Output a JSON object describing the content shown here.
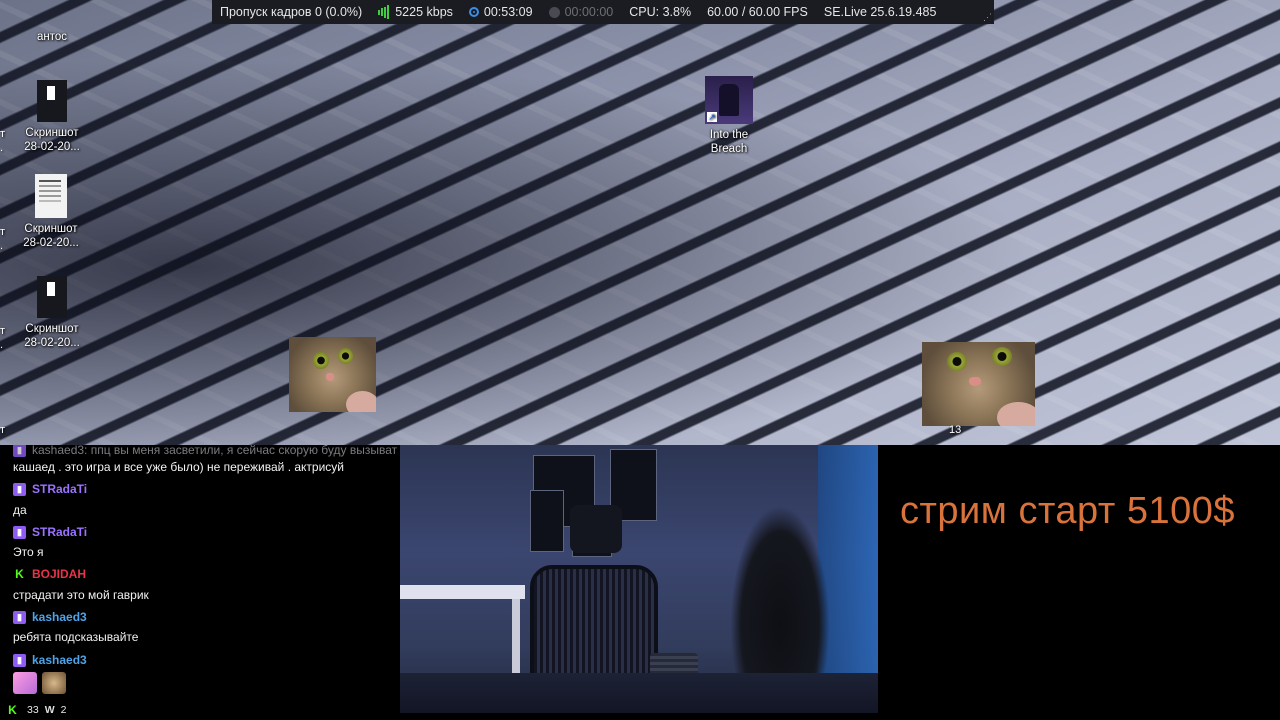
{
  "stats_bar": {
    "dropped_frames": "Пропуск кадров 0 (0.0%)",
    "bitrate": "5225 kbps",
    "stream_time": "00:53:09",
    "record_time": "00:00:00",
    "cpu": "CPU: 3.8%",
    "fps": "60.00 / 60.00 FPS",
    "version": "SE.Live 25.6.19.485",
    "bitrate_icon": "signal-bars-icon",
    "stream_icon": "broadcast-icon",
    "record_icon": "record-dot-icon",
    "colors": {
      "background": "#1b1c22",
      "signal": "#3ecf3e",
      "broadcast": "#3a8fe6"
    }
  },
  "desktop": {
    "top_label": "антос",
    "icons": [
      {
        "label_line1": "Скриншот",
        "label_line2": "28-02-20...",
        "thumb": "dark-screenshot"
      },
      {
        "label_line1": "Скриншот",
        "label_line2": "28-02-20...",
        "thumb": "document-screenshot"
      },
      {
        "label_line1": "Скриншот",
        "label_line2": "28-02-20...",
        "thumb": "dark-screenshot"
      }
    ],
    "game_shortcut": {
      "label_line1": "Into the",
      "label_line2": "Breach",
      "icon": "game-shortcut-icon"
    },
    "edge_labels": [
      "т",
      ".",
      "т",
      ".",
      "т",
      ".",
      "т"
    ],
    "cat_caption": "13"
  },
  "chat": {
    "partial_top": "kashaed3: ппц вы меня засветили, я сейчас скорую буду вызыват",
    "lines": [
      {
        "type": "msg",
        "text": "кашаед . это игра и все уже было) не переживай . актрисуй"
      },
      {
        "type": "name",
        "user": "STRadaTi",
        "badge": "twitch",
        "color": "#9b73ff"
      },
      {
        "type": "msg",
        "text": "да"
      },
      {
        "type": "name",
        "user": "STRadaTi",
        "badge": "twitch",
        "color": "#9b73ff"
      },
      {
        "type": "msg",
        "text": "Это я"
      },
      {
        "type": "name",
        "user": "BOJIDAH",
        "badge": "kick",
        "color": "#e8344a"
      },
      {
        "type": "msg",
        "text": "страдати это мой гаврик"
      },
      {
        "type": "name",
        "user": "kashaed3",
        "badge": "twitch",
        "color": "#4fa3e8"
      },
      {
        "type": "msg",
        "text": "ребята подсказывайте"
      },
      {
        "type": "name",
        "user": "kashaed3",
        "badge": "twitch",
        "color": "#4fa3e8"
      }
    ],
    "footer": {
      "kick_viewers": "33",
      "other_viewers": "2"
    }
  },
  "stream_overlay": {
    "start_text": "стрим старт 5100$",
    "color": "#d9733b"
  }
}
